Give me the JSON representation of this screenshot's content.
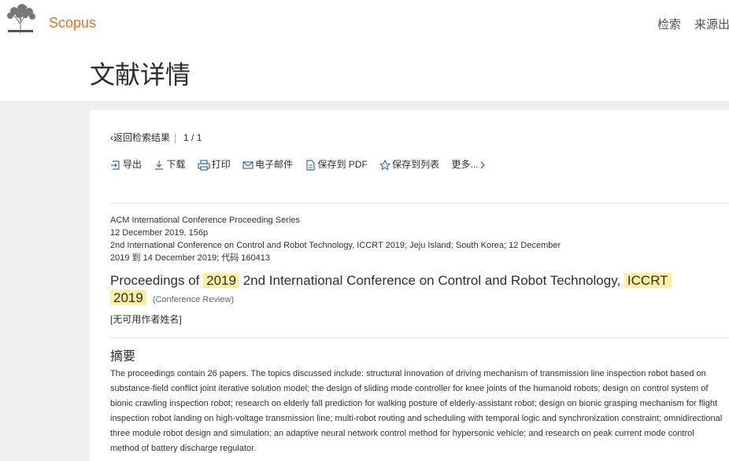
{
  "header": {
    "brand": "Scopus",
    "nav": [
      "检索",
      "来源出"
    ],
    "page_title": "文献详情",
    "logo_icon": "elsevier-tree-logo",
    "brand_color": "#e9711c"
  },
  "navigation": {
    "back_label": "返回检索结果",
    "pager": "1 / 1"
  },
  "toolbar": [
    {
      "label": "导出",
      "icon": "export-icon"
    },
    {
      "label": "下载",
      "icon": "download-icon"
    },
    {
      "label": "打印",
      "icon": "print-icon"
    },
    {
      "label": "电子邮件",
      "icon": "email-icon"
    },
    {
      "label": "保存到 PDF",
      "icon": "pdf-icon"
    },
    {
      "label": "保存到列表",
      "icon": "star-icon"
    },
    {
      "label": "更多...",
      "icon": "chevron-right-icon"
    }
  ],
  "document": {
    "series": "ACM International Conference Proceeding Series",
    "date_pages": "12 December 2019, 156p",
    "conference_line1": "2nd International Conference on Control and Robot Technology, ICCRT 2019; Jeju Island; South Korea; 12 December",
    "conference_line2": "2019 到 14 December 2019; 代码 160413",
    "title_part1": "Proceedings of",
    "title_hl1": "2019",
    "title_part2": "2nd International Conference on Control and Robot Technology,",
    "title_hl2": "ICCRT",
    "title_hl3": "2019",
    "doc_type": "(Conference Review)",
    "authors": "[无可用作者姓名]",
    "highlight_color": "#fff0a0"
  },
  "abstract": {
    "heading": "摘要",
    "text": "The proceedings contain 26 papers. The topics discussed include: structural innovation of driving mechanism of transmission line inspection robot based on substance-field conflict joint iterative solution model; the design of sliding mode controller for knee joints of the humanoid robots; design on control system of bionic crawling inspection robot; research on elderly fall prediction for walking posture of elderly-assistant robot; design on bionic grasping mechanism for flight inspection robot landing on high-voltage transmission line; multi-robot routing and scheduling with temporal logic and synchronization constraint; omnidirectional three module robot design and simulation; an adaptive neural network control method for hypersonic vehicle; and research on peak current mode control method of battery discharge regulator."
  }
}
